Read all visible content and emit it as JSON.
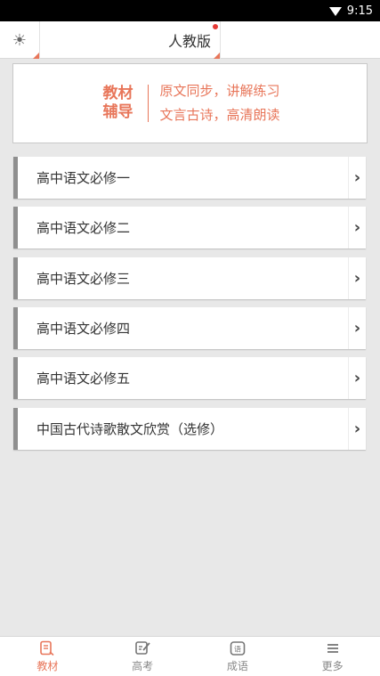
{
  "status_bar": {
    "time": "9:15",
    "wifi_icon": "wifi-icon"
  },
  "top_bar": {
    "brightness_icon": "brightness-icon",
    "edition_label": "人教版",
    "accent": "#e8765a"
  },
  "banner": {
    "title_line1": "教材",
    "title_line2": "辅导",
    "line1": "原文同步，讲解练习",
    "line2": "文言古诗，高清朗读"
  },
  "list": {
    "items": [
      {
        "label": "高中语文必修一"
      },
      {
        "label": "高中语文必修二"
      },
      {
        "label": "高中语文必修三"
      },
      {
        "label": "高中语文必修四"
      },
      {
        "label": "高中语文必修五"
      },
      {
        "label": "中国古代诗歌散文欣赏（选修）"
      }
    ],
    "arrow_icon": "chevron-right-icon"
  },
  "bottom_nav": {
    "tabs": [
      {
        "label": "教材",
        "icon": "book-icon",
        "active": true
      },
      {
        "label": "高考",
        "icon": "exam-icon",
        "active": false
      },
      {
        "label": "成语",
        "icon": "idiom-icon",
        "active": false
      },
      {
        "label": "更多",
        "icon": "menu-icon",
        "active": false
      }
    ]
  }
}
